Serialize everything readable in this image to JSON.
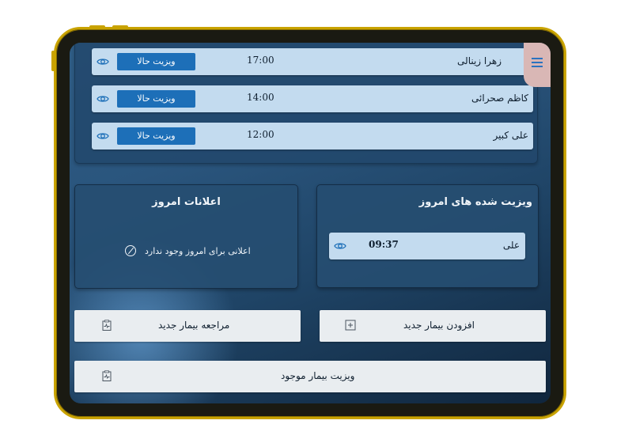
{
  "upcoming": [
    {
      "name": "زهرا زینالی",
      "time": "17:00",
      "action": "ویزیت حالا"
    },
    {
      "name": "کاظم صحرائی",
      "time": "14:00",
      "action": "ویزیت حالا"
    },
    {
      "name": "علی کبیر",
      "time": "12:00",
      "action": "ویزیت حالا"
    }
  ],
  "visited_panel": {
    "title": "ویزیت شده های امروز",
    "items": [
      {
        "name": "علی",
        "time": "09:37"
      }
    ]
  },
  "notifications_panel": {
    "title": "اعلانات امروز",
    "empty_text": "اعلانی برای امروز وجود ندارد"
  },
  "actions": {
    "add_new_patient": "افزودن بیمار جدید",
    "new_patient_referral": "مراجعه بیمار جدید",
    "visit_existing_patient": "ویزیت بیمار موجود"
  },
  "icons": {
    "menu": "hamburger-icon",
    "view": "eye-icon",
    "add": "plus-box-icon",
    "clipboard": "clipboard-pulse-icon",
    "empty": "ban-icon"
  },
  "colors": {
    "accent": "#1d6fb8",
    "row_bg": "#c3dbef",
    "frame": "#c9a300"
  }
}
